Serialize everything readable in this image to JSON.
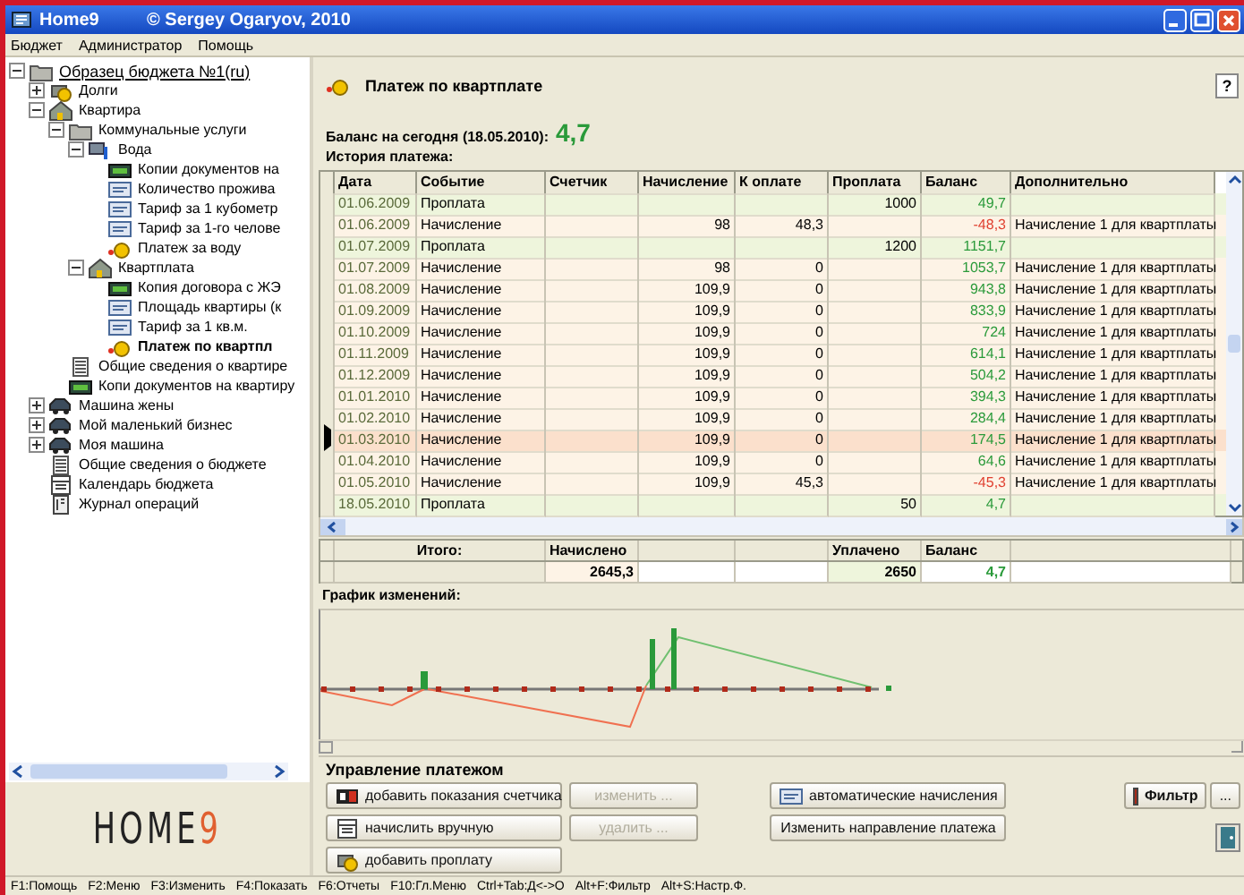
{
  "window": {
    "title": "Home9",
    "copyright": "© Sergey Ogaryov, 2010"
  },
  "menu": [
    "Бюджет",
    "Администратор",
    "Помощь"
  ],
  "tree": [
    {
      "label": "Образец бюджета №1(ru)",
      "kind": "folder",
      "expanded": true,
      "selected": false,
      "children": [
        {
          "label": "Долги",
          "kind": "coin",
          "expanded": false,
          "selected": false
        },
        {
          "label": "Квартира",
          "kind": "house",
          "expanded": true,
          "selected": false,
          "children": [
            {
              "label": "Коммунальные услуги",
              "kind": "folder",
              "expanded": true,
              "selected": false,
              "children": [
                {
                  "label": "Вода",
                  "kind": "tap",
                  "expanded": true,
                  "selected": false,
                  "children": [
                    {
                      "label": "Копии документов на",
                      "kind": "doc",
                      "selected": false
                    },
                    {
                      "label": "Количество прожива",
                      "kind": "card",
                      "selected": false
                    },
                    {
                      "label": "Тариф за 1 кубометр",
                      "kind": "card",
                      "selected": false
                    },
                    {
                      "label": "Тариф за 1-го челове",
                      "kind": "card",
                      "selected": false
                    },
                    {
                      "label": "Платеж за воду",
                      "kind": "payment",
                      "selected": false
                    }
                  ]
                },
                {
                  "label": "Квартплата",
                  "kind": "house",
                  "expanded": true,
                  "selected": false,
                  "children": [
                    {
                      "label": "Копия договора с ЖЭ",
                      "kind": "doc",
                      "selected": false
                    },
                    {
                      "label": "Площадь квартиры (к",
                      "kind": "card",
                      "selected": false
                    },
                    {
                      "label": "Тариф за 1 кв.м.",
                      "kind": "card",
                      "selected": false
                    },
                    {
                      "label": "Платеж по квартпл",
                      "kind": "payment",
                      "selected": true
                    }
                  ]
                }
              ]
            },
            {
              "label": "Общие сведения о квартире",
              "kind": "info",
              "selected": false
            },
            {
              "label": "Копи документов на квартиру",
              "kind": "doc",
              "selected": false
            }
          ]
        },
        {
          "label": "Машина жены",
          "kind": "car",
          "expanded": false,
          "selected": false
        },
        {
          "label": "Мой маленький бизнес",
          "kind": "car",
          "expanded": false,
          "selected": false
        },
        {
          "label": "Моя машина",
          "kind": "car",
          "expanded": false,
          "selected": false
        },
        {
          "label": "Общие сведения о бюджете",
          "kind": "info",
          "selected": false
        },
        {
          "label": "Календарь бюджета",
          "kind": "calendar",
          "selected": false
        },
        {
          "label": "Журнал операций",
          "kind": "journal",
          "selected": false
        }
      ]
    }
  ],
  "logo": {
    "word": "HOME",
    "digit": "9"
  },
  "panel": {
    "title": "Платеж по квартплате",
    "help": "?",
    "balance_label": "Баланс на сегодня (18.05.2010):",
    "balance": "4,7",
    "history_label": "История платежа:"
  },
  "table": {
    "columns": [
      "Дата",
      "Событие",
      "Счетчик",
      "Начисление",
      "К оплате",
      "Проплата",
      "Баланс",
      "Дополнительно"
    ],
    "rows": [
      {
        "kind": "payment",
        "selected": false,
        "negative": false,
        "date": "01.06.2009",
        "event": "Проплата",
        "paid": "1000",
        "balance": "49,7"
      },
      {
        "kind": "accrual",
        "selected": false,
        "negative": true,
        "date": "01.06.2009",
        "event": "Начисление",
        "accrued": "98",
        "to_pay": "48,3",
        "balance": "-48,3",
        "note": "Начисление 1 для квартплаты"
      },
      {
        "kind": "payment",
        "selected": false,
        "negative": false,
        "date": "01.07.2009",
        "event": "Проплата",
        "paid": "1200",
        "balance": "1151,7"
      },
      {
        "kind": "accrual",
        "selected": false,
        "negative": false,
        "date": "01.07.2009",
        "event": "Начисление",
        "accrued": "98",
        "to_pay": "0",
        "balance": "1053,7",
        "note": "Начисление 1 для квартплаты"
      },
      {
        "kind": "accrual",
        "selected": false,
        "negative": false,
        "date": "01.08.2009",
        "event": "Начисление",
        "accrued": "109,9",
        "to_pay": "0",
        "balance": "943,8",
        "note": "Начисление 1 для квартплаты"
      },
      {
        "kind": "accrual",
        "selected": false,
        "negative": false,
        "date": "01.09.2009",
        "event": "Начисление",
        "accrued": "109,9",
        "to_pay": "0",
        "balance": "833,9",
        "note": "Начисление 1 для квартплаты"
      },
      {
        "kind": "accrual",
        "selected": false,
        "negative": false,
        "date": "01.10.2009",
        "event": "Начисление",
        "accrued": "109,9",
        "to_pay": "0",
        "balance": "724",
        "note": "Начисление 1 для квартплаты"
      },
      {
        "kind": "accrual",
        "selected": false,
        "negative": false,
        "date": "01.11.2009",
        "event": "Начисление",
        "accrued": "109,9",
        "to_pay": "0",
        "balance": "614,1",
        "note": "Начисление 1 для квартплаты"
      },
      {
        "kind": "accrual",
        "selected": false,
        "negative": false,
        "date": "01.12.2009",
        "event": "Начисление",
        "accrued": "109,9",
        "to_pay": "0",
        "balance": "504,2",
        "note": "Начисление 1 для квартплаты"
      },
      {
        "kind": "accrual",
        "selected": false,
        "negative": false,
        "date": "01.01.2010",
        "event": "Начисление",
        "accrued": "109,9",
        "to_pay": "0",
        "balance": "394,3",
        "note": "Начисление 1 для квартплаты"
      },
      {
        "kind": "accrual",
        "selected": false,
        "negative": false,
        "date": "01.02.2010",
        "event": "Начисление",
        "accrued": "109,9",
        "to_pay": "0",
        "balance": "284,4",
        "note": "Начисление 1 для квартплаты"
      },
      {
        "kind": "accrual",
        "selected": true,
        "negative": false,
        "date": "01.03.2010",
        "event": "Начисление",
        "accrued": "109,9",
        "to_pay": "0",
        "balance": "174,5",
        "note": "Начисление 1 для квартплаты"
      },
      {
        "kind": "accrual",
        "selected": false,
        "negative": false,
        "date": "01.04.2010",
        "event": "Начисление",
        "accrued": "109,9",
        "to_pay": "0",
        "balance": "64,6",
        "note": "Начисление 1 для квартплаты"
      },
      {
        "kind": "accrual",
        "selected": false,
        "negative": true,
        "date": "01.05.2010",
        "event": "Начисление",
        "accrued": "109,9",
        "to_pay": "45,3",
        "balance": "-45,3",
        "note": "Начисление 1 для квартплаты"
      },
      {
        "kind": "payment",
        "selected": false,
        "negative": false,
        "date": "18.05.2010",
        "event": "Проплата",
        "paid": "50",
        "balance": "4,7"
      }
    ]
  },
  "totals": {
    "label": "Итого:",
    "accrued_label": "Начислено",
    "accrued": "2645,3",
    "paid_label": "Уплачено",
    "paid": "2650",
    "balance_label": "Баланс",
    "balance": "4,7"
  },
  "chart": {
    "title": "График изменений:"
  },
  "controls": {
    "title": "Управление платежом",
    "edit_buttons": [
      {
        "label": "добавить показания счетчика",
        "kind": "counter",
        "disabled": false
      },
      {
        "label": "изменить ...",
        "kind": "plain",
        "disabled": true
      },
      {
        "label": "начислить вручную",
        "kind": "calendar",
        "disabled": false
      },
      {
        "label": "удалить ...",
        "kind": "plain",
        "disabled": true
      },
      {
        "label": "добавить проплату",
        "kind": "coin",
        "disabled": false
      }
    ],
    "payment_buttons": [
      {
        "label": "автоматические начисления",
        "kind": "card",
        "disabled": false
      },
      {
        "label": "Изменить направление платежа",
        "kind": "plain",
        "disabled": false
      }
    ],
    "filter": {
      "label": "Фильтр"
    },
    "more": "..."
  },
  "status_bar": [
    "F1:Помощь",
    "F2:Меню",
    "F3:Изменить",
    "F4:Показать",
    "F6:Отчеты",
    "F10:Гл.Меню",
    "Ctrl+Tab:Д<->О",
    "Alt+F:Фильтр",
    "Alt+S:Настр.Ф."
  ]
}
